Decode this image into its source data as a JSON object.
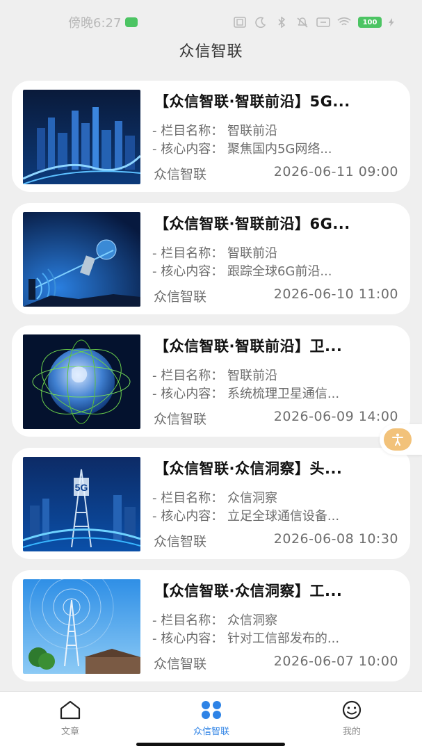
{
  "status_bar": {
    "time": "傍晚6:27",
    "battery": "100",
    "icons": [
      "nfc-icon",
      "moon-icon",
      "bluetooth-icon",
      "mute-icon",
      "sim-icon",
      "wifi-icon",
      "battery-icon",
      "charging-icon"
    ]
  },
  "header": {
    "title": "众信智联"
  },
  "articles": [
    {
      "title": "【众信智联·智联前沿】5G...",
      "column_line": "- 栏目名称： 智联前沿",
      "content_line": "- 核心内容： 聚焦国内5G网络...",
      "source": "众信智联",
      "date": "2026-06-11 09:00",
      "thumb": "city-night"
    },
    {
      "title": "【众信智联·智联前沿】6G...",
      "column_line": "- 栏目名称： 智联前沿",
      "content_line": "- 核心内容： 跟踪全球6G前沿...",
      "source": "众信智联",
      "date": "2026-06-10 11:00",
      "thumb": "signal-globe"
    },
    {
      "title": "【众信智联·智联前沿】卫...",
      "column_line": "- 栏目名称： 智联前沿",
      "content_line": "- 核心内容： 系统梳理卫星通信...",
      "source": "众信智联",
      "date": "2026-06-09 14:00",
      "thumb": "earth-satellite"
    },
    {
      "title": "【众信智联·众信洞察】头...",
      "column_line": "- 栏目名称： 众信洞察",
      "content_line": "- 核心内容： 立足全球通信设备...",
      "source": "众信智联",
      "date": "2026-06-08 10:30",
      "thumb": "5g-tower",
      "thumb_text": "5G"
    },
    {
      "title": "【众信智联·众信洞察】工...",
      "column_line": "- 栏目名称： 众信洞察",
      "content_line": "- 核心内容： 针对工信部发布的...",
      "source": "众信智联",
      "date": "2026-06-07 10:00",
      "thumb": "radio-tower"
    }
  ],
  "float_button": {
    "icon": "accessibility-icon",
    "color": "#f2c27a"
  },
  "bottom_nav": {
    "items": [
      {
        "label": "文章",
        "icon": "home-icon",
        "active": false
      },
      {
        "label": "众信智联",
        "icon": "four-petal-icon",
        "active": true
      },
      {
        "label": "我的",
        "icon": "smiley-icon",
        "active": false
      }
    ],
    "active_color": "#2e83e6"
  }
}
